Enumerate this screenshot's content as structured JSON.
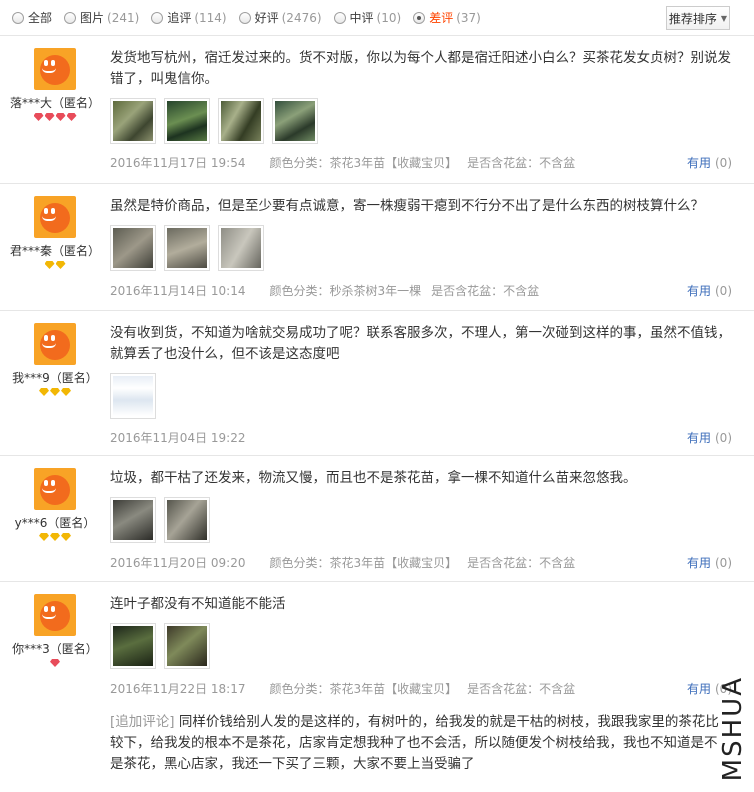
{
  "filters": [
    {
      "label": "全部",
      "count": "",
      "checked": false
    },
    {
      "label": "图片",
      "count": "(241)",
      "checked": false
    },
    {
      "label": "追评",
      "count": "(114)",
      "checked": false
    },
    {
      "label": "好评",
      "count": "(2476)",
      "checked": false
    },
    {
      "label": "中评",
      "count": "(10)",
      "checked": false
    },
    {
      "label": "差评",
      "count": "(37)",
      "checked": true
    }
  ],
  "sort_button": "推荐排序",
  "useful_label": "有用",
  "reviews": [
    {
      "user": "落***大（匿名）",
      "badge": "red-gems-4",
      "text": "发货地写杭州，宿迁发过来的。货不对版，你以为每个人都是宿迁阳述小白么？买茶花发女贞树？别说发错了，叫鬼信你。",
      "photos": 4,
      "date": "2016年11月17日 19:54",
      "sku": "颜色分类：茶花3年苗【收藏宝贝】",
      "pot": "是否含花盆：不含盆",
      "useful_count": "(0)"
    },
    {
      "user": "君***秦（匿名）",
      "badge": "gold-gems-2",
      "text": "虽然是特价商品，但是至少要有点诚意，寄一株瘦弱干瘪到不行分不出了是什么东西的树枝算什么？",
      "photos": 3,
      "date": "2016年11月14日 10:14",
      "sku": "颜色分类：秒杀茶树3年一棵",
      "pot": "是否含花盆：不含盆",
      "useful_count": "(0)"
    },
    {
      "user": "我***9（匿名）",
      "badge": "gold-gems-3",
      "text": "没有收到货，不知道为啥就交易成功了呢？联系客服多次，不理人，第一次碰到这样的事，虽然不值钱，就算丢了也没什么，但不该是这态度吧",
      "photos": 1,
      "date": "2016年11月04日 19:22",
      "sku": "",
      "pot": "",
      "useful_count": "(0)"
    },
    {
      "user": "y***6（匿名）",
      "badge": "gold-gems-3",
      "text": "垃圾，都干枯了还发来，物流又慢，而且也不是茶花苗，拿一棵不知道什么苗来忽悠我。",
      "photos": 2,
      "date": "2016年11月20日 09:20",
      "sku": "颜色分类：茶花3年苗【收藏宝贝】",
      "pot": "是否含花盆：不含盆",
      "useful_count": "(0)"
    },
    {
      "user": "你***3（匿名）",
      "badge": "red-gems-1",
      "text": "连叶子都没有不知道能不能活",
      "photos": 2,
      "date": "2016年11月22日 18:17",
      "sku": "颜色分类：茶花3年苗【收藏宝贝】",
      "pot": "是否含花盆：不含盆",
      "useful_count": "(0)",
      "append_tag": "[追加评论]",
      "append_text": "同样价钱给别人发的是这样的，有树叶的，给我发的就是干枯的树枝，我跟我家里的茶花比较下，给我发的根本不是茶花，店家肯定想我种了也不会活，所以随便发个树枝给我，我也不知道是不是茶花，黑心店家，我还一下买了三颗，大家不要上当受骗了"
    }
  ],
  "watermark": "MSHUA"
}
